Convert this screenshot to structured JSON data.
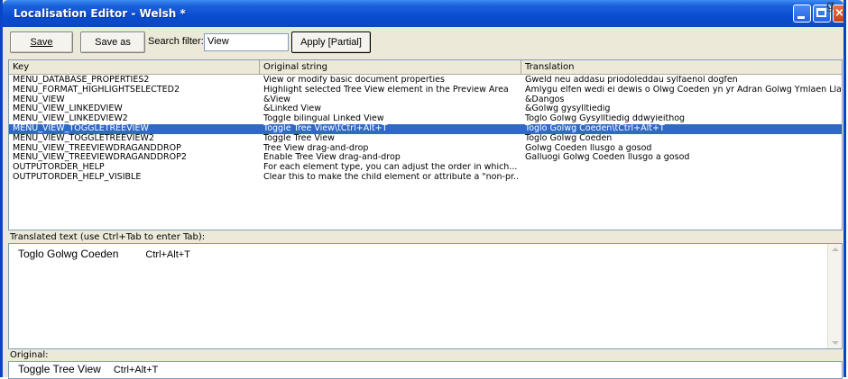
{
  "window": {
    "title": "Localisation Editor - Welsh *",
    "offscreen_glyph": "g"
  },
  "toolbar": {
    "save_label": "Save",
    "save_as_label": "Save as",
    "search_filter_label": "Search filter:",
    "search_filter_value": "View",
    "apply_label": "Apply [Partial]"
  },
  "grid": {
    "headers": [
      "Key",
      "Original string",
      "Translation"
    ],
    "selected_index": 5,
    "rows": [
      [
        "MENU_DATABASE_PROPERTIES2",
        "View or modify basic document properties",
        "Gweld neu addasu priodoleddau sylfaenol dogfen"
      ],
      [
        "MENU_FORMAT_HIGHLIGHTSELECTED2",
        "Highlight selected Tree View element in the Preview Area",
        "Amlygu elfen wedi ei dewis o Olwg Coeden yn yr Adran Golwg Ymlaen Llaw"
      ],
      [
        "MENU_VIEW",
        "&View",
        "&Dangos"
      ],
      [
        "MENU_VIEW_LINKEDVIEW",
        "&Linked View",
        "&Golwg gysylltiedig"
      ],
      [
        "MENU_VIEW_LINKEDVIEW2",
        "Toggle bilingual Linked View",
        "Toglo Golwg Gysylltiedig ddwyieithog"
      ],
      [
        "MENU_VIEW_TOGGLETREEVIEW",
        "Toggle Tree View\\tCtrl+Alt+T",
        "Toglo Golwg Coeden\\tCtrl+Alt+T"
      ],
      [
        "MENU_VIEW_TOGGLETREEVIEW2",
        "Toggle Tree View",
        "Toglo Golwg Coeden"
      ],
      [
        "MENU_VIEW_TREEVIEWDRAGANDDROP",
        "Tree View drag-and-drop",
        "Golwg Coeden llusgo a gosod"
      ],
      [
        "MENU_VIEW_TREEVIEWDRAGANDDROP2",
        "Enable Tree View drag-and-drop",
        "Galluogi Golwg Coeden llusgo a gosod"
      ],
      [
        "OUTPUTORDER_HELP",
        "For each element type, you can adjust the order in which...",
        ""
      ],
      [
        "OUTPUTORDER_HELP_VISIBLE",
        "Clear this to make the child element or attribute a \"non-pr...",
        ""
      ]
    ]
  },
  "translated": {
    "label": "Translated text (use Ctrl+Tab to enter Tab):",
    "text": "Toglo Golwg Coeden",
    "shortcut": "Ctrl+Alt+T"
  },
  "original": {
    "label": "Original:",
    "text": "Toggle Tree View",
    "shortcut": "Ctrl+Alt+T"
  }
}
